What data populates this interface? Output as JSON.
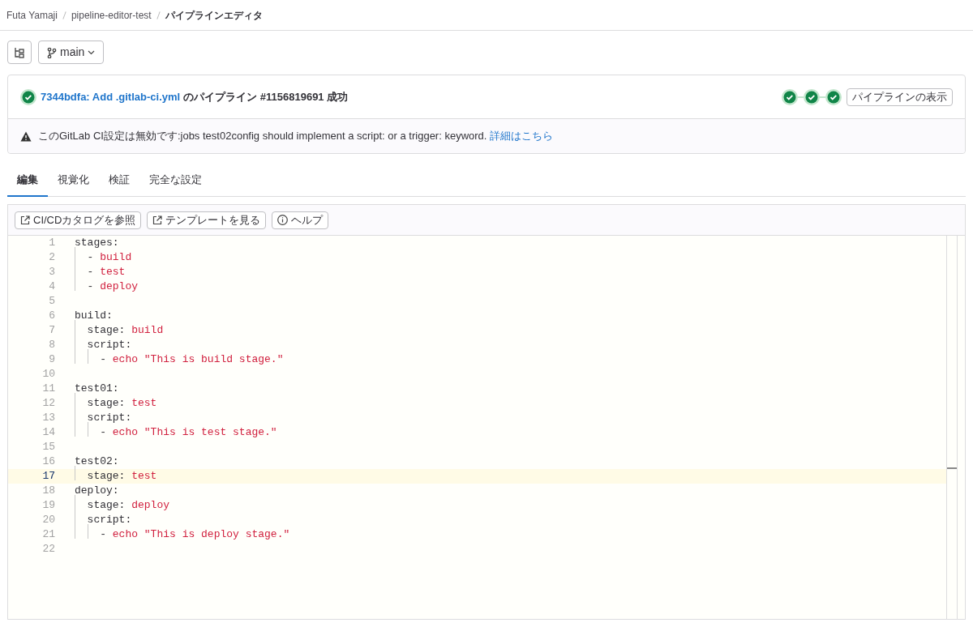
{
  "breadcrumbs": [
    {
      "label": "Futa Yamaji",
      "current": false
    },
    {
      "label": "pipeline-editor-test",
      "current": false
    },
    {
      "label": "パイプラインエディタ",
      "current": true
    }
  ],
  "branch": {
    "label": "main"
  },
  "pipeline": {
    "link": "7344bdfa: Add .gitlab-ci.yml",
    "text": "のパイプライン #1156819691 成功",
    "view_button": "パイプラインの表示"
  },
  "alert": {
    "message": "このGitLab CI設定は無効です:jobs test02config should implement a script: or a trigger: keyword.",
    "link": "詳細はこちら"
  },
  "tabs": [
    {
      "label": "編集",
      "selected": true
    },
    {
      "label": "視覚化",
      "selected": false
    },
    {
      "label": "検証",
      "selected": false
    },
    {
      "label": "完全な設定",
      "selected": false
    }
  ],
  "toolbar": [
    {
      "kind": "external",
      "label": "CI/CDカタログを参照"
    },
    {
      "kind": "external",
      "label": "テンプレートを見る"
    },
    {
      "kind": "help",
      "label": "ヘルプ"
    }
  ],
  "editor": {
    "lines": [
      {
        "number": "1",
        "key": "stages:",
        "current": false
      },
      {
        "number": "2",
        "key": "  - ",
        "value": "build",
        "current": false
      },
      {
        "number": "3",
        "key": "  - ",
        "value": "test",
        "current": false
      },
      {
        "number": "4",
        "key": "  - ",
        "value": "deploy",
        "current": false
      },
      {
        "number": "5",
        "current": false
      },
      {
        "number": "6",
        "key": "build:",
        "current": false
      },
      {
        "number": "7",
        "key": "  stage: ",
        "value": "build",
        "current": false
      },
      {
        "number": "8",
        "key": "  script:",
        "current": false
      },
      {
        "number": "9",
        "key": "    - ",
        "value": "echo \"This is build stage.\"",
        "current": false
      },
      {
        "number": "10",
        "current": false
      },
      {
        "number": "11",
        "key": "test01:",
        "current": false
      },
      {
        "number": "12",
        "key": "  stage: ",
        "value": "test",
        "current": false
      },
      {
        "number": "13",
        "key": "  script:",
        "current": false
      },
      {
        "number": "14",
        "key": "    - ",
        "value": "echo \"This is test stage.\"",
        "current": false
      },
      {
        "number": "15",
        "current": false
      },
      {
        "number": "16",
        "key": "test02:",
        "current": false
      },
      {
        "number": "17",
        "key": "  stage: ",
        "value": "test",
        "current": true
      },
      {
        "number": "18",
        "key": "deploy:",
        "current": false
      },
      {
        "number": "19",
        "key": "  stage: ",
        "value": "deploy",
        "current": false
      },
      {
        "number": "20",
        "key": "  script:",
        "current": false
      },
      {
        "number": "21",
        "key": "    - ",
        "value": "echo \"This is deploy stage.\"",
        "current": false
      },
      {
        "number": "22",
        "current": false
      }
    ]
  }
}
